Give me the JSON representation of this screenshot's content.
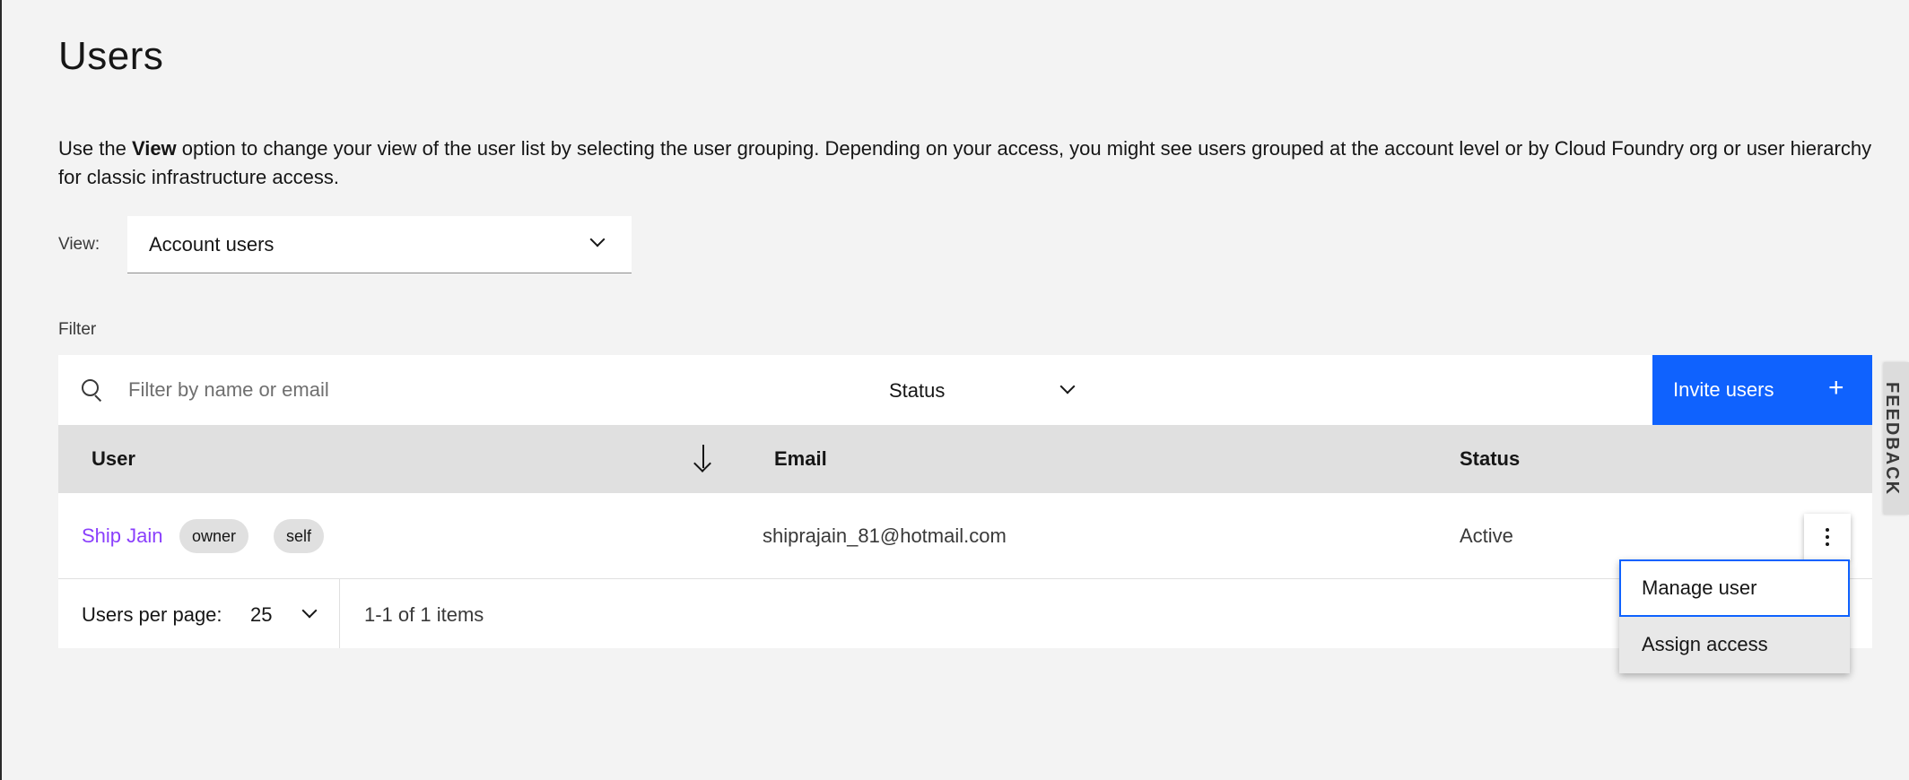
{
  "page": {
    "title": "Users",
    "description_prefix": "Use the ",
    "description_bold": "View",
    "description_suffix": " option to change your view of the user list by selecting the user grouping. Depending on your access, you might see users grouped at the account level or by Cloud Foundry org or user hierarchy for classic infrastructure access."
  },
  "view": {
    "label": "View:",
    "selected": "Account users"
  },
  "filter": {
    "label": "Filter",
    "search_placeholder": "Filter by name or email",
    "status_label": "Status"
  },
  "toolbar": {
    "invite_label": "Invite users",
    "invite_icon": "+"
  },
  "table": {
    "headers": [
      "User",
      "Email",
      "Status"
    ],
    "rows": [
      {
        "name": "Ship Jain",
        "tags": [
          "owner",
          "self"
        ],
        "email": "shiprajain_81@hotmail.com",
        "status": "Active"
      }
    ]
  },
  "pagination": {
    "per_page_label": "Users per page:",
    "per_page_value": "25",
    "items_text": "1-1 of 1 items"
  },
  "overflow_menu": {
    "items": [
      "Manage user",
      "Assign access"
    ]
  },
  "feedback": {
    "label": "FEEDBACK"
  },
  "colors": {
    "primary": "#0f62fe",
    "link": "#8a3ffc",
    "background": "#f3f3f3",
    "header_bg": "#e0e0e0"
  }
}
